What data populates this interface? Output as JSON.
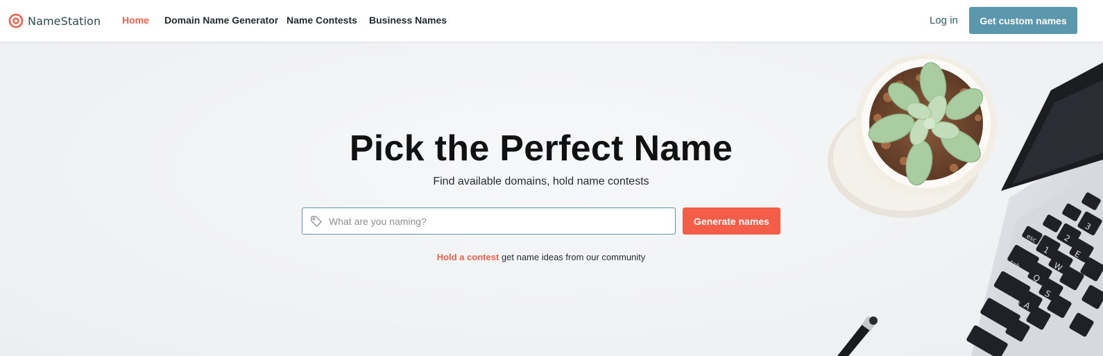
{
  "brand": {
    "name": "NameStation",
    "logo_icon": "target-logo-icon",
    "accent_color": "#f45d48",
    "secondary_color": "#5b98ad"
  },
  "nav": {
    "items": [
      {
        "label": "Home",
        "active": true
      },
      {
        "label": "Domain Name Generator",
        "active": false
      },
      {
        "label": "Name Contests",
        "active": false
      },
      {
        "label": "Business Names",
        "active": false
      }
    ],
    "login_label": "Log in",
    "cta_label": "Get custom names"
  },
  "hero": {
    "title": "Pick the Perfect Name",
    "subtitle": "Find available domains, hold name contests",
    "search": {
      "placeholder": "What are you naming?",
      "value": "",
      "icon": "tag-icon"
    },
    "generate_label": "Generate names",
    "contest_link": "Hold a contest",
    "contest_text": " get name ideas from our community"
  },
  "decor": {
    "image": "succulent-plant-and-laptop-photo",
    "keys": [
      "esc",
      "tab",
      "caps lock",
      "shift",
      "Q",
      "W",
      "E",
      "A",
      "S",
      "1",
      "2",
      "3"
    ]
  }
}
